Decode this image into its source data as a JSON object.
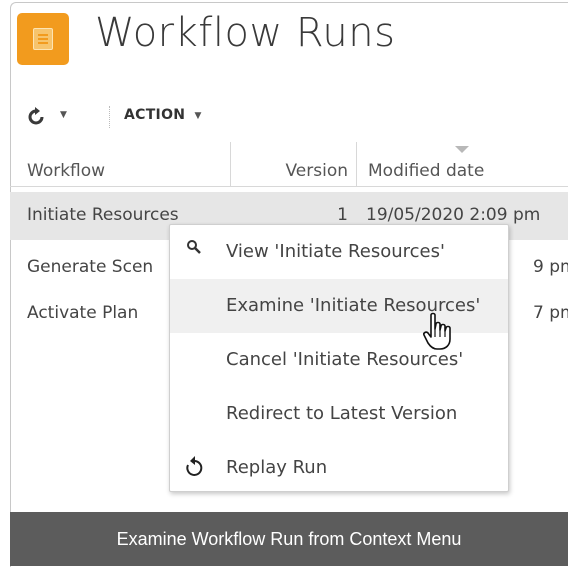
{
  "header": {
    "title": "Workflow Runs"
  },
  "toolbar": {
    "action_label": "ACTION"
  },
  "grid": {
    "columns": [
      "Workflow",
      "Version",
      "Modified date"
    ],
    "rows": [
      {
        "workflow": "Initiate Resources",
        "version": "1",
        "modified": "19/05/2020 2:09 pm"
      },
      {
        "workflow": "Generate Scen",
        "version": "",
        "modified": "9 pm"
      },
      {
        "workflow": "Activate Plan",
        "version": "",
        "modified": "7 pm"
      }
    ]
  },
  "context_menu": {
    "items": [
      {
        "label": "View 'Initiate Resources'",
        "icon": "search-icon"
      },
      {
        "label": "Examine 'Initiate Resources'",
        "icon": ""
      },
      {
        "label": "Cancel 'Initiate Resources'",
        "icon": ""
      },
      {
        "label": "Redirect to Latest Version",
        "icon": ""
      },
      {
        "label": "Replay Run",
        "icon": "replay-icon"
      }
    ]
  },
  "caption": "Examine Workflow Run from Context Menu",
  "colors": {
    "app_icon": "#f29b1e",
    "selected_row": "#e6e6e6",
    "caption_bg": "#5c5c5c"
  }
}
